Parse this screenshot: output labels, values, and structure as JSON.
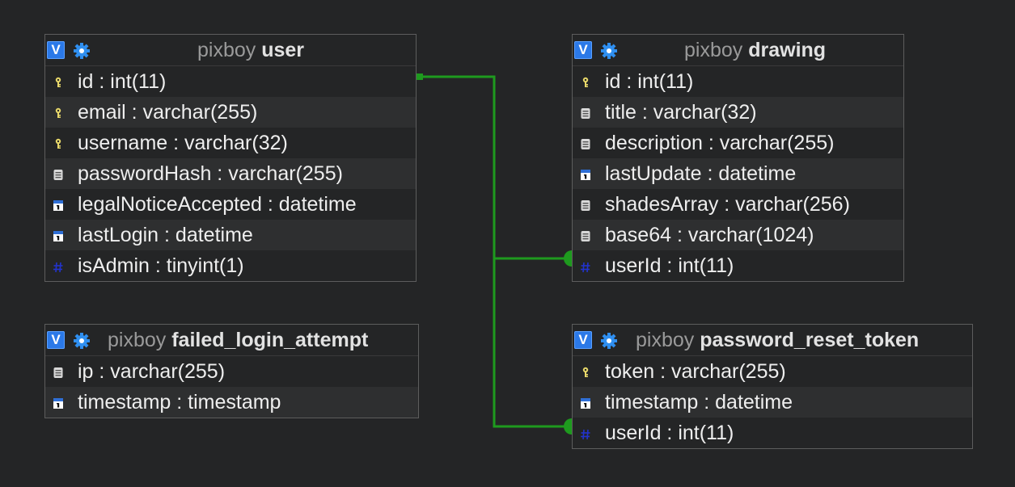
{
  "tables": {
    "user": {
      "db": "pixboy",
      "name": "user",
      "toggle": "V",
      "columns": [
        {
          "label": "id : int(11)",
          "icon": "key-icon"
        },
        {
          "label": "email : varchar(255)",
          "icon": "key-icon"
        },
        {
          "label": "username : varchar(32)",
          "icon": "key-icon"
        },
        {
          "label": "passwordHash : varchar(255)",
          "icon": "text-icon"
        },
        {
          "label": "legalNoticeAccepted : datetime",
          "icon": "date-icon"
        },
        {
          "label": "lastLogin : datetime",
          "icon": "date-icon"
        },
        {
          "label": "isAdmin : tinyint(1)",
          "icon": "number-icon"
        }
      ]
    },
    "drawing": {
      "db": "pixboy",
      "name": "drawing",
      "toggle": "V",
      "columns": [
        {
          "label": "id : int(11)",
          "icon": "key-icon"
        },
        {
          "label": "title : varchar(32)",
          "icon": "text-icon"
        },
        {
          "label": "description : varchar(255)",
          "icon": "text-icon"
        },
        {
          "label": "lastUpdate : datetime",
          "icon": "date-icon"
        },
        {
          "label": "shadesArray : varchar(256)",
          "icon": "text-icon"
        },
        {
          "label": "base64 : varchar(1024)",
          "icon": "text-icon"
        },
        {
          "label": "userId : int(11)",
          "icon": "number-icon"
        }
      ]
    },
    "failed_login_attempt": {
      "db": "pixboy",
      "name": "failed_login_attempt",
      "toggle": "V",
      "columns": [
        {
          "label": "ip : varchar(255)",
          "icon": "text-icon"
        },
        {
          "label": "timestamp : timestamp",
          "icon": "date-icon"
        }
      ]
    },
    "password_reset_token": {
      "db": "pixboy",
      "name": "password_reset_token",
      "toggle": "V",
      "columns": [
        {
          "label": "token : varchar(255)",
          "icon": "key-icon"
        },
        {
          "label": "timestamp : datetime",
          "icon": "date-icon"
        },
        {
          "label": "userId : int(11)",
          "icon": "number-icon"
        }
      ]
    }
  },
  "relations": [
    {
      "from": "user.id",
      "to": "drawing.userId"
    },
    {
      "from": "user.id",
      "to": "password_reset_token.userId"
    }
  ],
  "colors": {
    "background": "#242526",
    "relation_line": "#1e9a1e",
    "toggle_button": "#2b79e8",
    "key_icon": "#e8d86a",
    "number_icon": "#2233cc"
  }
}
